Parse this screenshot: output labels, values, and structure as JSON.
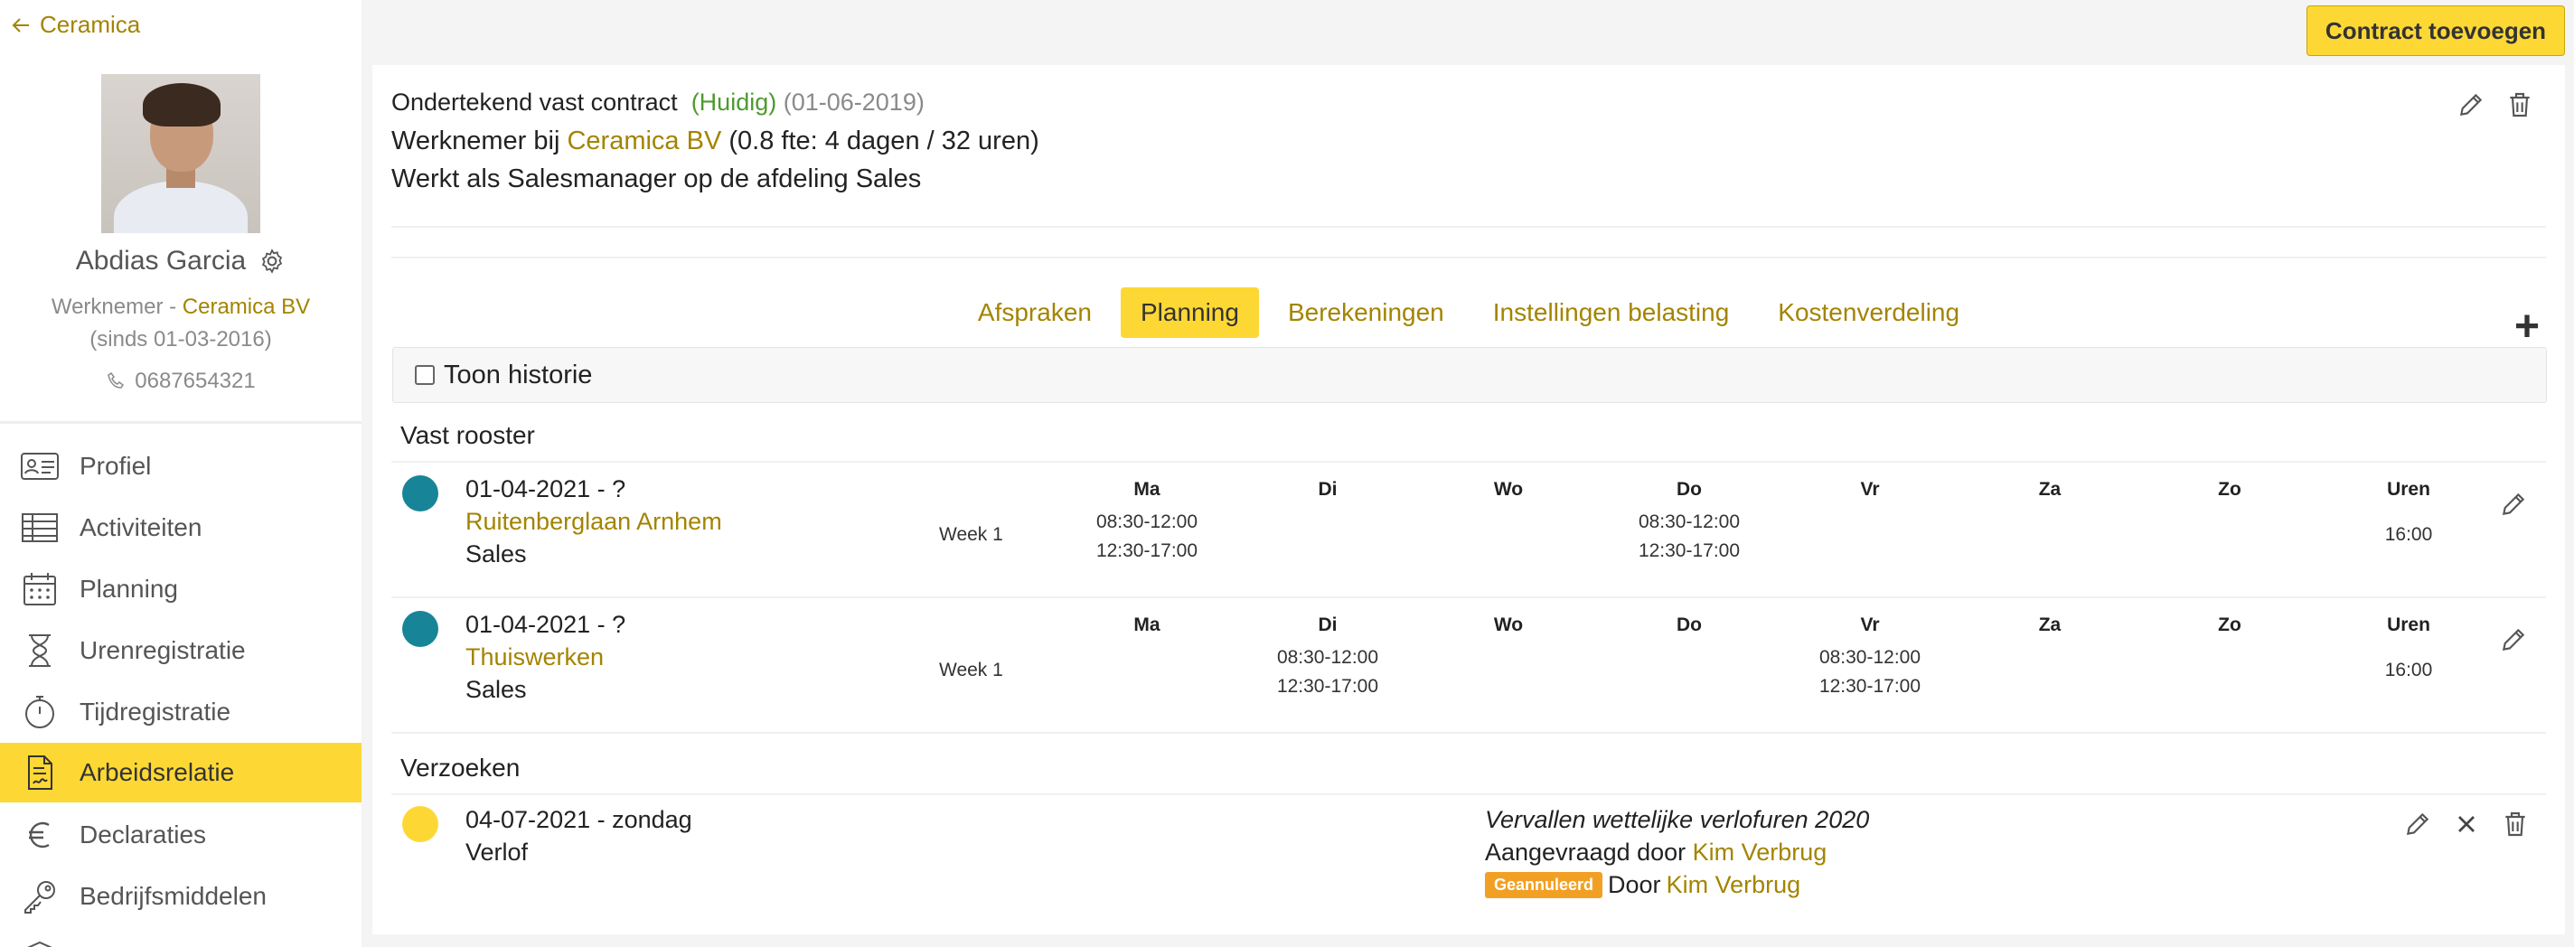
{
  "sidebar": {
    "back_label": "Ceramica",
    "person_name": "Abdias Garcia",
    "role_prefix": "Werknemer - ",
    "company": "Ceramica BV",
    "since": "(sinds 01-03-2016)",
    "phone": "0687654321",
    "nav": [
      {
        "label": "Profiel",
        "icon": "id-card-icon"
      },
      {
        "label": "Activiteiten",
        "icon": "table-icon"
      },
      {
        "label": "Planning",
        "icon": "calendar-icon"
      },
      {
        "label": "Urenregistratie",
        "icon": "hourglass-icon"
      },
      {
        "label": "Tijdregistratie",
        "icon": "stopwatch-icon"
      },
      {
        "label": "Arbeidsrelatie",
        "icon": "contract-icon",
        "active": true
      },
      {
        "label": "Declaraties",
        "icon": "euro-icon"
      },
      {
        "label": "Bedrijfsmiddelen",
        "icon": "key-icon"
      }
    ]
  },
  "header": {
    "add_contract_label": "Contract toevoegen"
  },
  "contract": {
    "title": "Ondertekend vast contract",
    "status": "(Huidig)",
    "date": "(01-06-2019)",
    "employer_prefix": "Werknemer bij ",
    "employer": "Ceramica BV",
    "fte": " (0.8 fte: 4 dagen / 32 uren)",
    "function": "Werkt als Salesmanager op de afdeling Sales"
  },
  "tabs": [
    {
      "label": "Afspraken"
    },
    {
      "label": "Planning",
      "active": true
    },
    {
      "label": "Berekeningen"
    },
    {
      "label": "Instellingen belasting"
    },
    {
      "label": "Kostenverdeling"
    }
  ],
  "history_label": "Toon historie",
  "schedule_title": "Vast rooster",
  "day_headers": [
    "Ma",
    "Di",
    "Wo",
    "Do",
    "Vr",
    "Za",
    "Zo",
    "Uren"
  ],
  "schedules": [
    {
      "date": "01-04-2021 - ?",
      "location": "Ruitenberglaan Arnhem",
      "department": "Sales",
      "week": "Week 1",
      "ma_1": "08:30-12:00",
      "ma_2": "12:30-17:00",
      "di_1": "",
      "di_2": "",
      "do_1": "08:30-12:00",
      "do_2": "12:30-17:00",
      "vr_1": "",
      "vr_2": "",
      "hours": "16:00"
    },
    {
      "date": "01-04-2021 - ?",
      "location": "Thuiswerken",
      "department": "Sales",
      "week": "Week 1",
      "ma_1": "",
      "ma_2": "",
      "di_1": "08:30-12:00",
      "di_2": "12:30-17:00",
      "do_1": "",
      "do_2": "",
      "vr_1": "08:30-12:00",
      "vr_2": "12:30-17:00",
      "hours": "16:00"
    }
  ],
  "requests_title": "Verzoeken",
  "request": {
    "date": "04-07-2021 - zondag",
    "type": "Verlof",
    "reason": "Vervallen wettelijke verlofuren 2020",
    "requested_prefix": "Aangevraagd door ",
    "requested_by": "Kim Verbrug",
    "badge": "Geannuleerd",
    "cancelled_prefix": "Door ",
    "cancelled_by": "Kim Verbrug"
  },
  "colors": {
    "accent": "#fdd835",
    "link": "#a38400",
    "current": "#4e9a2f",
    "schedule_dot": "#178597",
    "badge": "#f2a024"
  }
}
